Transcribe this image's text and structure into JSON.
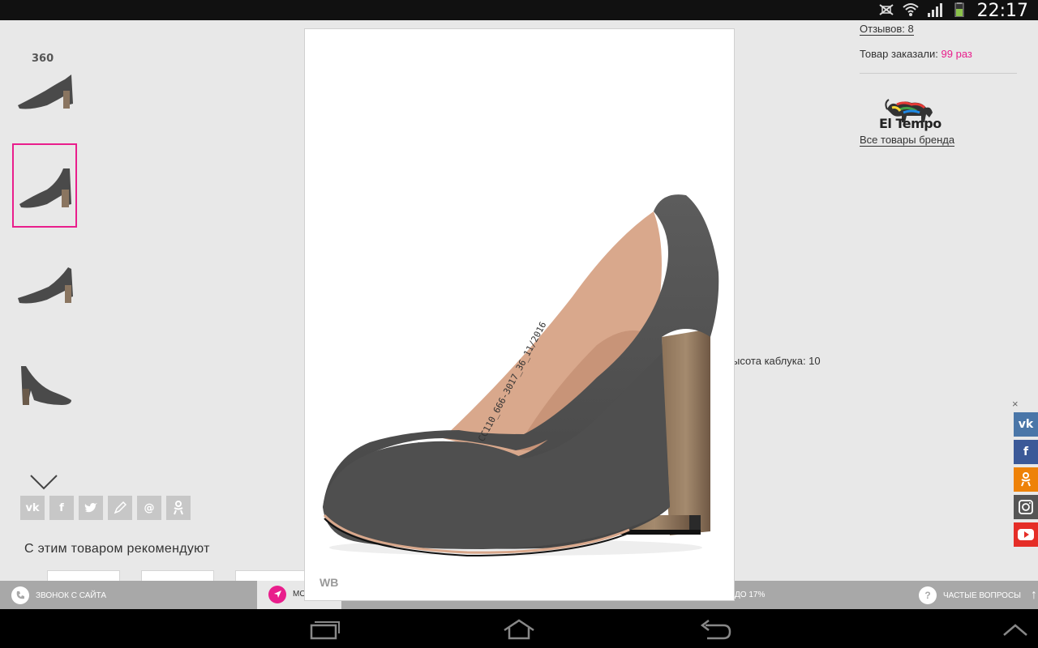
{
  "status_bar": {
    "time": "22:17",
    "icons": [
      "mute-icon",
      "wifi-icon",
      "signal-icon",
      "battery-icon"
    ]
  },
  "thumbnails": {
    "badge": "360",
    "selected_index": 1
  },
  "share_left": [
    "vk",
    "f",
    "tw",
    "lj",
    "@",
    "ok"
  ],
  "recommend_title": "С этим товаром рекомендуют",
  "right_panel": {
    "reviews": "Отзывов: 8",
    "ordered_label": "Товар заказали:",
    "ordered_value": "99 раз",
    "brand_name": "El Tempo",
    "brand_link": "Все товары бренда",
    "heel_height": "ысота каблука: 10"
  },
  "social_right": {
    "close": "×",
    "items": [
      "vk",
      "f",
      "ok",
      "ig",
      "yt"
    ],
    "colors": {
      "vk": "#4a76a8",
      "f": "#3b5998",
      "ok": "#ee8208",
      "ig": "#555555",
      "yt": "#e52d27"
    }
  },
  "modal": {
    "label": "WB",
    "insole_text": "CC110_666-3017_36_11/2016"
  },
  "bottom_bar": {
    "call_label": "ЗВОНОК С САЙТА",
    "active_label": "МО",
    "discount_label": "ДО 17%",
    "faq_label": "ЧАСТЫЕ ВОПРОСЫ",
    "faq_icon": "?",
    "call_icon": "phone-icon"
  },
  "colors": {
    "accent": "#e91e8c",
    "page_bg": "#e8e8e8",
    "bar": "#a8a8a8"
  }
}
